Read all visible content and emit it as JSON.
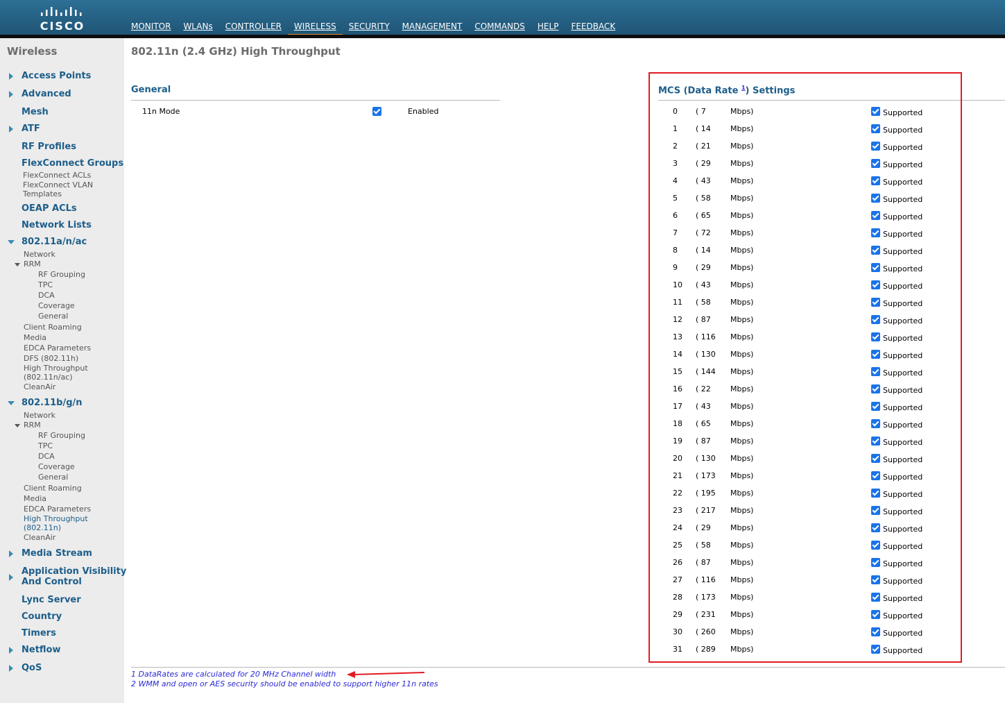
{
  "header": {
    "logo_text": "CISCO",
    "nav": [
      {
        "label": "MONITOR"
      },
      {
        "label": "WLANs"
      },
      {
        "label": "CONTROLLER"
      },
      {
        "label": "WIRELESS"
      },
      {
        "label": "SECURITY"
      },
      {
        "label": "MANAGEMENT"
      },
      {
        "label": "COMMANDS"
      },
      {
        "label": "HELP"
      },
      {
        "label": "FEEDBACK"
      }
    ],
    "active_nav": "WIRELESS",
    "accent_color": "#e38a2b"
  },
  "sidebar": {
    "title": "Wireless",
    "access_points": "Access Points",
    "advanced": "Advanced",
    "mesh": "Mesh",
    "atf": "ATF",
    "rf_profiles": "RF Profiles",
    "flexconnect_groups": "FlexConnect Groups",
    "flexconnect_acls": "FlexConnect ACLs",
    "flexconnect_vlan": "FlexConnect VLAN",
    "templates": "Templates",
    "oeap_acls": "OEAP ACLs",
    "network_lists": "Network Lists",
    "a_band": {
      "label": "802.11a/n/ac",
      "network": "Network",
      "rrm": "RRM",
      "rf_grouping": "RF Grouping",
      "tpc": "TPC",
      "dca": "DCA",
      "coverage": "Coverage",
      "general": "General",
      "client_roaming": "Client Roaming",
      "media": "Media",
      "edca": "EDCA Parameters",
      "dfs": "DFS (802.11h)",
      "high_throughput": "High Throughput",
      "high_throughput_sub": "(802.11n/ac)",
      "cleanair": "CleanAir"
    },
    "b_band": {
      "label": "802.11b/g/n",
      "network": "Network",
      "rrm": "RRM",
      "rf_grouping": "RF Grouping",
      "tpc": "TPC",
      "dca": "DCA",
      "coverage": "Coverage",
      "general": "General",
      "client_roaming": "Client Roaming",
      "media": "Media",
      "edca": "EDCA Parameters",
      "high_throughput": "High Throughput",
      "high_throughput_sub": "(802.11n)",
      "cleanair": "CleanAir"
    },
    "media_stream": "Media Stream",
    "app_visibility_1": "Application Visibility",
    "app_visibility_2": "And Control",
    "lync_server": "Lync Server",
    "country": "Country",
    "timers": "Timers",
    "netflow": "Netflow",
    "qos": "QoS"
  },
  "main": {
    "page_title": "802.11n (2.4 GHz) High Throughput",
    "general": {
      "title": "General",
      "mode_label": "11n Mode",
      "mode_checked": true,
      "mode_state": "Enabled"
    },
    "mcs": {
      "title_pre": "MCS (Data Rate ",
      "title_sup": "1",
      "title_post": ") Settings",
      "unit": "Mbps)",
      "status": "Supported",
      "rows": [
        {
          "index": "0",
          "rate": "( 7"
        },
        {
          "index": "1",
          "rate": "( 14"
        },
        {
          "index": "2",
          "rate": "( 21"
        },
        {
          "index": "3",
          "rate": "( 29"
        },
        {
          "index": "4",
          "rate": "( 43"
        },
        {
          "index": "5",
          "rate": "( 58"
        },
        {
          "index": "6",
          "rate": "( 65"
        },
        {
          "index": "7",
          "rate": "( 72"
        },
        {
          "index": "8",
          "rate": "( 14"
        },
        {
          "index": "9",
          "rate": "( 29"
        },
        {
          "index": "10",
          "rate": "( 43"
        },
        {
          "index": "11",
          "rate": "( 58"
        },
        {
          "index": "12",
          "rate": "( 87"
        },
        {
          "index": "13",
          "rate": "( 116"
        },
        {
          "index": "14",
          "rate": "( 130"
        },
        {
          "index": "15",
          "rate": "( 144"
        },
        {
          "index": "16",
          "rate": "( 22"
        },
        {
          "index": "17",
          "rate": "( 43"
        },
        {
          "index": "18",
          "rate": "( 65"
        },
        {
          "index": "19",
          "rate": "( 87"
        },
        {
          "index": "20",
          "rate": "( 130"
        },
        {
          "index": "21",
          "rate": "( 173"
        },
        {
          "index": "22",
          "rate": "( 195"
        },
        {
          "index": "23",
          "rate": "( 217"
        },
        {
          "index": "24",
          "rate": "( 29"
        },
        {
          "index": "25",
          "rate": "( 58"
        },
        {
          "index": "26",
          "rate": "( 87"
        },
        {
          "index": "27",
          "rate": "( 116"
        },
        {
          "index": "28",
          "rate": "( 173"
        },
        {
          "index": "29",
          "rate": "( 231"
        },
        {
          "index": "30",
          "rate": "( 260"
        },
        {
          "index": "31",
          "rate": "( 289"
        }
      ]
    },
    "footnotes": {
      "note1": "1 DataRates are calculated for 20 MHz Channel width",
      "note2": "2 WMM and open or AES security should be enabled to support higher 11n rates"
    },
    "highlight_color": "#e11b22"
  }
}
